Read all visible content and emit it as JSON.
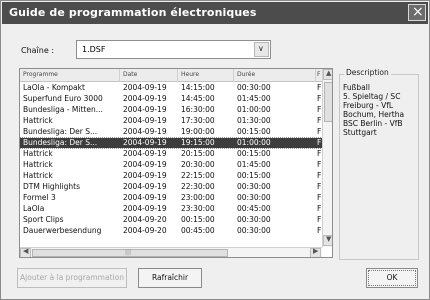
{
  "window": {
    "title": "Guide de programmation électroniques",
    "close_glyph": "×"
  },
  "channel": {
    "label": "Chaîne :",
    "value": "1.DSF",
    "dropdown_glyph": "∨"
  },
  "list": {
    "columns": [
      "Programme",
      "Date",
      "Heure",
      "Durée",
      "F"
    ],
    "rows": [
      [
        "LaOla - Kompakt",
        "2004-09-19",
        "14:15:00",
        "00:30:00",
        "F"
      ],
      [
        "Superfund Euro 3000",
        "2004-09-19",
        "14:45:00",
        "01:45:00",
        "F"
      ],
      [
        "Bundesliga - Mitten...",
        "2004-09-19",
        "16:30:00",
        "01:00:00",
        "F"
      ],
      [
        "Hattrick",
        "2004-09-19",
        "17:30:00",
        "01:30:00",
        "F"
      ],
      [
        "Bundesliga: Der S...",
        "2004-09-19",
        "19:00:00",
        "00:15:00",
        "F"
      ],
      [
        "Bundesliga: Der S...",
        "2004-09-19",
        "19:15:00",
        "01:00:00",
        "F"
      ],
      [
        "Hattrick",
        "2004-09-19",
        "20:15:00",
        "00:15:00",
        "F"
      ],
      [
        "Hattrick",
        "2004-09-19",
        "20:30:00",
        "01:45:00",
        "F"
      ],
      [
        "Hattrick",
        "2004-09-19",
        "22:15:00",
        "00:15:00",
        "F"
      ],
      [
        "DTM Highlights",
        "2004-09-19",
        "22:30:00",
        "00:30:00",
        "F"
      ],
      [
        "Formel 3",
        "2004-09-19",
        "23:00:00",
        "00:30:00",
        "F"
      ],
      [
        "LaOla",
        "2004-09-19",
        "23:30:00",
        "00:45:00",
        "F"
      ],
      [
        "Sport Clips",
        "2004-09-20",
        "00:15:00",
        "00:30:00",
        "F"
      ],
      [
        "Dauerwerbesendung",
        "2004-09-20",
        "00:45:00",
        "00:30:00",
        "F"
      ]
    ],
    "selected_index": 5,
    "scroll_up_glyph": "▲",
    "scroll_down_glyph": "▼",
    "scroll_left_glyph": "◀",
    "scroll_right_glyph": "▶",
    "h_grip": "|||"
  },
  "description": {
    "label": "Description",
    "lines": [
      "Fußball",
      "5. Spieltag / SC",
      "Freiburg - VfL",
      "Bochum, Hertha",
      "BSC Berlin - VfB",
      "Stuttgart"
    ]
  },
  "buttons": {
    "add": "Ajouter à la programmation",
    "refresh": "Rafraîchir",
    "ok": "OK"
  },
  "colors": {
    "titlebar": "#4c4c4c",
    "selection": "#3d3d3d"
  }
}
